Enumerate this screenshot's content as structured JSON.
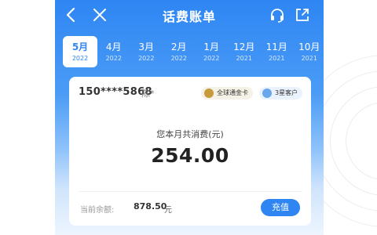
{
  "header": {
    "title": "话费账单",
    "back_icon": "chevron-left-icon",
    "close_icon": "close-icon",
    "service_icon": "headset-icon",
    "share_icon": "share-icon"
  },
  "months": [
    {
      "month": "5月",
      "year": "2022",
      "active": true
    },
    {
      "month": "4月",
      "year": "2022"
    },
    {
      "month": "3月",
      "year": "2022"
    },
    {
      "month": "2月",
      "year": "2022"
    },
    {
      "month": "1月",
      "year": "2022"
    },
    {
      "month": "12月",
      "year": "2021"
    },
    {
      "month": "11月",
      "year": "2021"
    },
    {
      "month": "10月",
      "year": "2021"
    }
  ],
  "account": {
    "phone": "150****5868",
    "name": "陈*",
    "badges": [
      {
        "label": "全球通金卡",
        "icon": "gold-card-icon",
        "color": "#c79a3c"
      },
      {
        "label": "3星客户",
        "icon": "star-icon",
        "color": "#6aa7ea"
      }
    ]
  },
  "bill": {
    "total_label": "您本月共消费(元)",
    "total_amount": "254.00",
    "balance_label": "当前余额:",
    "balance_value": "878.50",
    "balance_unit": "元",
    "recharge_label": "充值"
  },
  "colors": {
    "accent": "#2f86f3"
  }
}
